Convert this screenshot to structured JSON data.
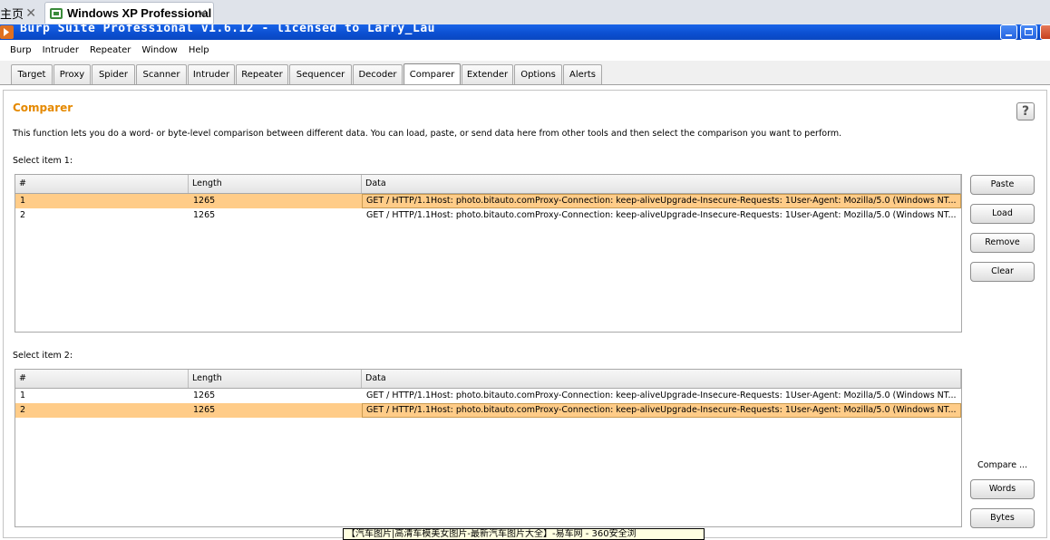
{
  "host": {
    "tabs": [
      {
        "label": "主页"
      },
      {
        "label": "Windows XP Professional"
      }
    ]
  },
  "window": {
    "title": "Burp Suite Professional v1.6.12 - licensed to Larry_Lau"
  },
  "menu": [
    "Burp",
    "Intruder",
    "Repeater",
    "Window",
    "Help"
  ],
  "tool_tabs": [
    "Target",
    "Proxy",
    "Spider",
    "Scanner",
    "Intruder",
    "Repeater",
    "Sequencer",
    "Decoder",
    "Comparer",
    "Extender",
    "Options",
    "Alerts"
  ],
  "active_tab": "Comparer",
  "comparer": {
    "title": "Comparer",
    "help": "?",
    "description": "This function lets you do a word- or byte-level comparison between different data. You can load, paste, or send data here from other tools and then select the comparison you want to perform.",
    "item1_label": "Select item 1:",
    "item2_label": "Select item 2:",
    "columns": [
      "#",
      "Length",
      "Data"
    ],
    "table1": [
      {
        "num": "1",
        "length": "1265",
        "data": "GET / HTTP/1.1Host: photo.bitauto.comProxy-Connection: keep-aliveUpgrade-Insecure-Requests: 1User-Agent: Mozilla/5.0 (Windows NT...",
        "selected": true
      },
      {
        "num": "2",
        "length": "1265",
        "data": "GET / HTTP/1.1Host: photo.bitauto.comProxy-Connection: keep-aliveUpgrade-Insecure-Requests: 1User-Agent: Mozilla/5.0 (Windows NT...",
        "selected": false
      }
    ],
    "table2": [
      {
        "num": "1",
        "length": "1265",
        "data": "GET / HTTP/1.1Host: photo.bitauto.comProxy-Connection: keep-aliveUpgrade-Insecure-Requests: 1User-Agent: Mozilla/5.0 (Windows NT...",
        "selected": false
      },
      {
        "num": "2",
        "length": "1265",
        "data": "GET / HTTP/1.1Host: photo.bitauto.comProxy-Connection: keep-aliveUpgrade-Insecure-Requests: 1User-Agent: Mozilla/5.0 (Windows NT...",
        "selected": true
      }
    ],
    "buttons": {
      "paste": "Paste",
      "load": "Load",
      "remove": "Remove",
      "clear": "Clear"
    },
    "compare_label": "Compare ...",
    "compare_buttons": {
      "words": "Words",
      "bytes": "Bytes"
    }
  },
  "tooltip": "【汽车图片|高清车模美女图片-最新汽车图片大全】-易车网 - 360安全浏",
  "colors": {
    "selected_row": "#ffcc88",
    "title_accent": "#e58900",
    "titlebar": "#0b4fd0"
  }
}
